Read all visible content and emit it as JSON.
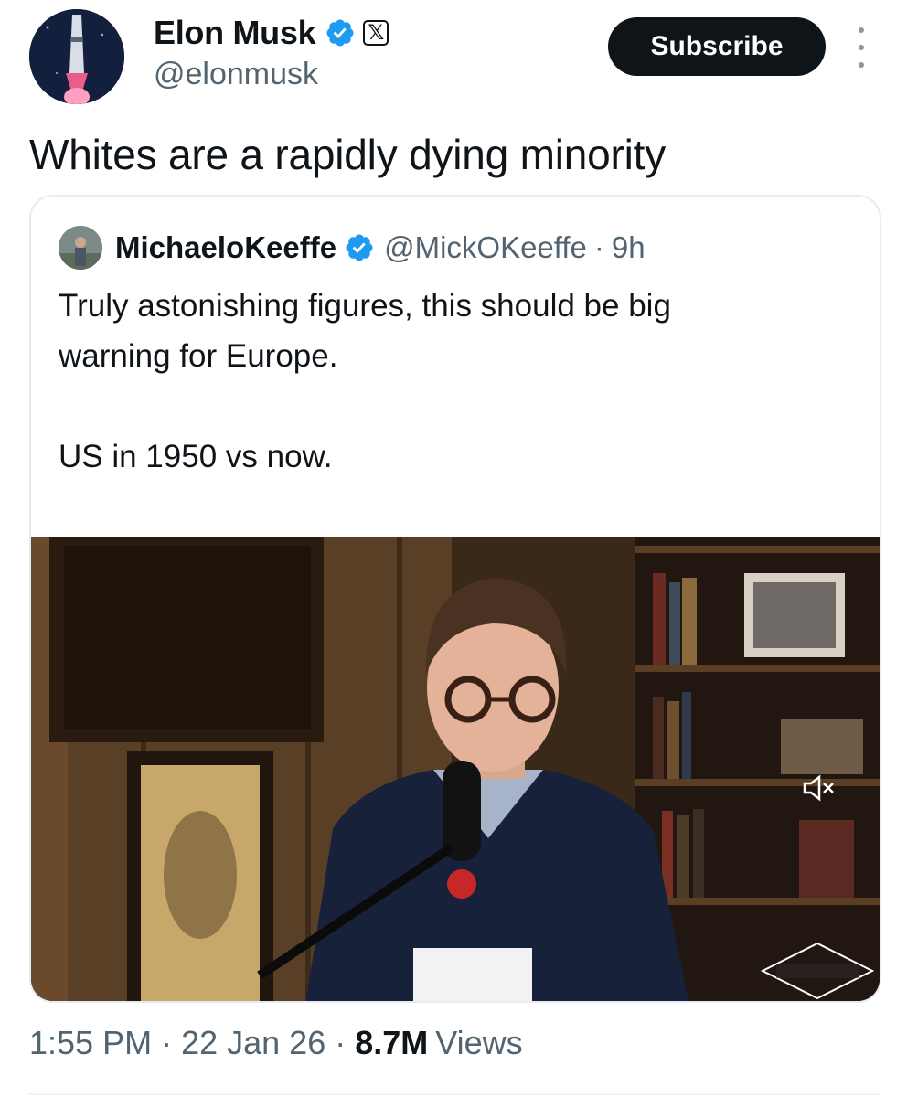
{
  "author": {
    "name": "Elon Musk",
    "handle": "@elonmusk",
    "badge_icon": "x-logo-badge",
    "verified_icon": "verified-badge-icon"
  },
  "actions": {
    "subscribe_label": "Subscribe",
    "more_icon": "more-options-icon"
  },
  "tweet": {
    "text": "Whites are a rapidly dying minority"
  },
  "quoted_tweet": {
    "name": "MichaeloKeeffe",
    "handle": "@MickOKeeffe",
    "separator": "·",
    "time": "9h",
    "text": "Truly astonishing figures, this should be big\nwarning for Europe.\n\nUS in 1950 vs now.",
    "ellipsis": "...",
    "media": {
      "mute_icon": "speaker-muted-icon"
    }
  },
  "meta": {
    "time": "1:55 PM",
    "separator": "·",
    "date": "22 Jan 26",
    "views_count": "8.7M",
    "views_label": "Views"
  },
  "colors": {
    "text": "#0f1419",
    "secondary": "#536471",
    "verified": "#1d9bf0",
    "button_bg": "#0f1419"
  }
}
